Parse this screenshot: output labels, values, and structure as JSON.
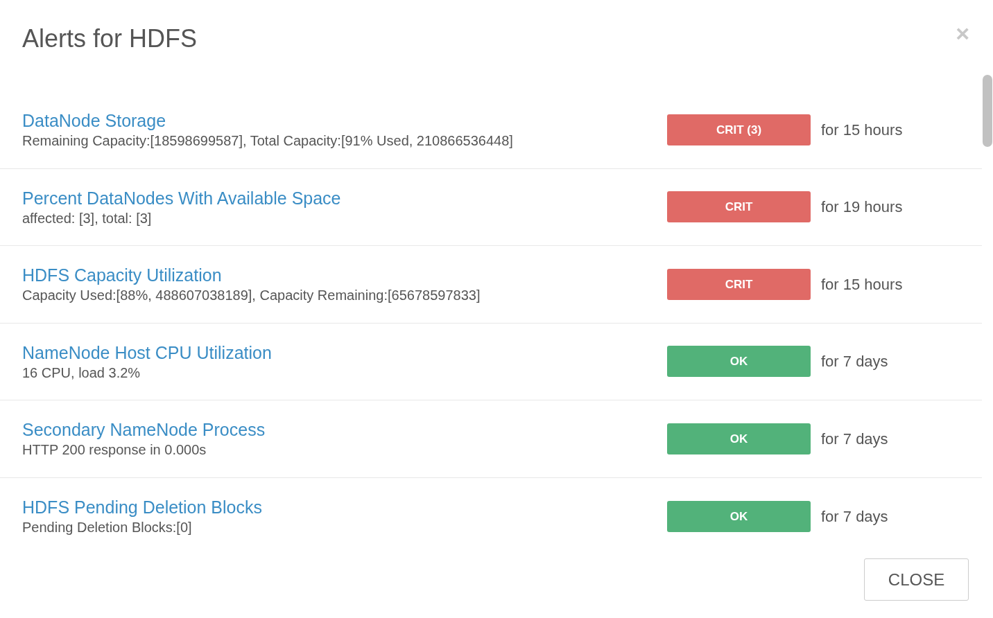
{
  "dialog": {
    "title": "Alerts for HDFS",
    "close_icon": "×"
  },
  "alerts": [
    {
      "name": "DataNode Storage",
      "text": "Remaining Capacity:[18598699587], Total Capacity:[91% Used, 210866536448]",
      "color": "#e06a66",
      "badge": "CRIT (3)",
      "duration": "for 15 hours"
    },
    {
      "name": "Percent DataNodes With Available Space",
      "text": "affected: [3], total: [3]",
      "color": "#e06a66",
      "badge": "CRIT",
      "duration": "for 19 hours"
    },
    {
      "name": "HDFS Capacity Utilization",
      "text": "Capacity Used:[88%, 488607038189], Capacity Remaining:[65678597833]",
      "color": "#e06a66",
      "badge": "CRIT",
      "duration": "for 15 hours"
    },
    {
      "name": "NameNode Host CPU Utilization",
      "text": "16 CPU, load 3.2%",
      "color": "#52b27a",
      "badge": "OK",
      "duration": "for 7 days"
    },
    {
      "name": "Secondary NameNode Process",
      "text": "HTTP 200 response in 0.000s",
      "color": "#52b27a",
      "badge": "OK",
      "duration": "for 7 days"
    },
    {
      "name": "HDFS Pending Deletion Blocks",
      "text": "Pending Deletion Blocks:[0]",
      "color": "#52b27a",
      "badge": "OK",
      "duration": "for 7 days"
    }
  ],
  "footer": {
    "close_button": "CLOSE"
  }
}
